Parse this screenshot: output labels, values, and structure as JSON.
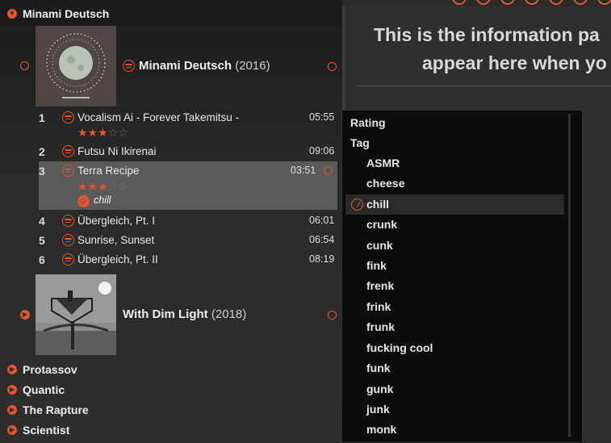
{
  "info_panel": {
    "line1": "This is the information pa",
    "line2": "appear here when yo"
  },
  "library": {
    "artist_expanded": "Minami Deutsch",
    "albums": [
      {
        "title": "Minami Deutsch",
        "year": "(2016)",
        "tracks": [
          {
            "num": "1",
            "title": "Vocalism Ai - Forever Takemitsu -",
            "duration": "05:55",
            "stars": 3
          },
          {
            "num": "2",
            "title": "Futsu Ni Ikirenai",
            "duration": "09:06"
          },
          {
            "num": "3",
            "title": "Terra Recipe",
            "duration": "03:51",
            "stars": 3,
            "tag": "chill"
          },
          {
            "num": "4",
            "title": "Übergleich, Pt. I",
            "duration": "06:01"
          },
          {
            "num": "5",
            "title": "Sunrise, Sunset",
            "duration": "06:54"
          },
          {
            "num": "6",
            "title": "Übergleich, Pt. II",
            "duration": "08:19"
          }
        ]
      },
      {
        "title": "With Dim Light",
        "year": "(2018)"
      }
    ],
    "other_artists": [
      "Protassov",
      "Quantic",
      "The Rapture",
      "Scientist"
    ]
  },
  "context_menu": {
    "rating_label": "Rating",
    "tag_label": "Tag",
    "tags": [
      "ASMR",
      "cheese",
      "chill",
      "crunk",
      "cunk",
      "fink",
      "frenk",
      "frink",
      "frunk",
      "fucking cool",
      "funk",
      "gunk",
      "junk",
      "monk"
    ],
    "selected_tag": "chill"
  },
  "colors": {
    "accent": "#e0562b",
    "selected_row": "#5a5a5a",
    "menu_bg": "#0c0c0c"
  }
}
